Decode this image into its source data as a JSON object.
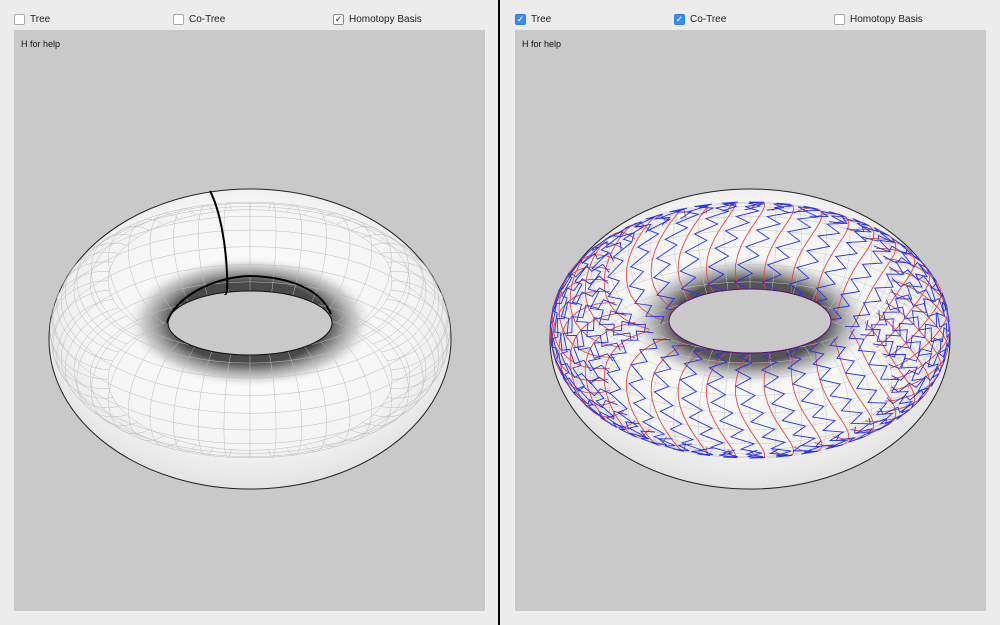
{
  "left_panel": {
    "checkboxes": [
      {
        "label": "Tree",
        "checked": false,
        "style": "unchecked"
      },
      {
        "label": "Co-Tree",
        "checked": false,
        "style": "unchecked"
      },
      {
        "label": "Homotopy Basis",
        "checked": true,
        "style": "checkmark"
      }
    ],
    "help_text": "H for help",
    "overlay": "homotopy-basis-loops",
    "colors": {
      "viewport_bg": "#c9c9c9",
      "loop": "#000000"
    }
  },
  "right_panel": {
    "checkboxes": [
      {
        "label": "Tree",
        "checked": true,
        "style": "blue"
      },
      {
        "label": "Co-Tree",
        "checked": true,
        "style": "blue"
      },
      {
        "label": "Homotopy Basis",
        "checked": false,
        "style": "unchecked"
      }
    ],
    "help_text": "H for help",
    "overlay": "tree-and-cotree",
    "colors": {
      "viewport_bg": "#c9c9c9",
      "tree": "#e8473b",
      "cotree": "#2233ee"
    }
  }
}
